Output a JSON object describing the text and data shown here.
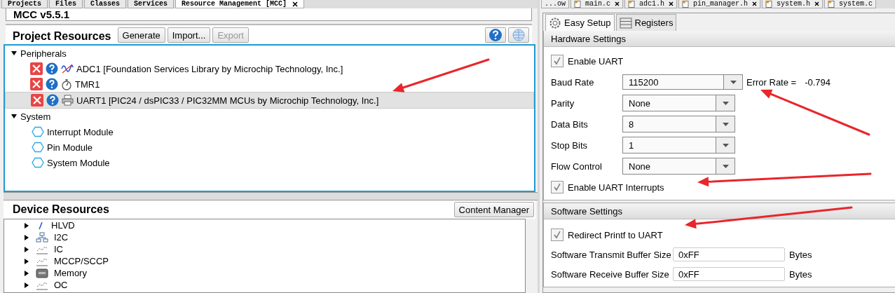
{
  "left_tabs": [
    {
      "label": "Projects",
      "selected": false
    },
    {
      "label": "Files",
      "selected": false
    },
    {
      "label": "Classes",
      "selected": false
    },
    {
      "label": "Services",
      "selected": false
    },
    {
      "label": "Resource Management [MCC]",
      "selected": true
    }
  ],
  "mcc_version": "MCC v5.5.1",
  "project_resources": {
    "title": "Project Resources",
    "buttons": [
      {
        "label": "Generate",
        "disabled": false
      },
      {
        "label": "Import...",
        "disabled": false
      },
      {
        "label": "Export",
        "disabled": true
      }
    ],
    "tree": [
      {
        "label": "Peripherals",
        "expanded": true,
        "children": [
          {
            "label": "ADC1 [Foundation Services Library by Microchip Technology, Inc.]",
            "kind": "wave",
            "selected": false
          },
          {
            "label": "TMR1",
            "kind": "stopwatch",
            "selected": false
          },
          {
            "label": "UART1 [PIC24 / dsPIC33 / PIC32MM MCUs by Microchip Technology, Inc.]",
            "kind": "printer",
            "selected": true
          }
        ]
      },
      {
        "label": "System",
        "expanded": true,
        "children": [
          {
            "label": "Interrupt Module",
            "kind": "hexagon",
            "selected": false
          },
          {
            "label": "Pin Module",
            "kind": "hexagon",
            "selected": false
          },
          {
            "label": "System Module",
            "kind": "hexagon",
            "selected": false
          }
        ]
      }
    ]
  },
  "device_resources": {
    "title": "Device Resources",
    "button": "Content Manager",
    "items": [
      {
        "label": "HLVD",
        "kind": "bolt",
        "expanded": false
      },
      {
        "label": "I2C",
        "kind": "network",
        "expanded": false
      },
      {
        "label": "IC",
        "kind": "signal",
        "expanded": false
      },
      {
        "label": "MCCP/SCCP",
        "kind": "signal",
        "expanded": false
      },
      {
        "label": "Memory",
        "kind": "chip",
        "expanded": false
      },
      {
        "label": "OC",
        "kind": "signal",
        "expanded": false
      }
    ]
  },
  "file_tabs": [
    {
      "label": "...ow",
      "selected": false
    },
    {
      "label": "main.c",
      "selected": false
    },
    {
      "label": "adc1.h",
      "selected": false
    },
    {
      "label": "pin_manager.h",
      "selected": false
    },
    {
      "label": "system.h",
      "selected": false
    },
    {
      "label": "system.c",
      "selected": false
    }
  ],
  "setup_tabs": [
    {
      "label": "Easy Setup",
      "kind": "gear",
      "selected": true
    },
    {
      "label": "Registers",
      "kind": "list",
      "selected": false
    }
  ],
  "hardware_settings": {
    "title": "Hardware Settings",
    "rows": [
      {
        "kind": "checkbox",
        "label": "Enable UART",
        "checked": true
      },
      {
        "kind": "dropdown",
        "label": "Baud Rate",
        "value": "115200",
        "note_label": "Error Rate =",
        "note_value": "-0.794"
      },
      {
        "kind": "dropdown",
        "label": "Parity",
        "value": "None"
      },
      {
        "kind": "dropdown",
        "label": "Data Bits",
        "value": "8"
      },
      {
        "kind": "dropdown",
        "label": "Stop Bits",
        "value": "1"
      },
      {
        "kind": "dropdown",
        "label": "Flow Control",
        "value": "None"
      },
      {
        "kind": "checkbox",
        "label": "Enable UART Interrupts",
        "checked": true
      }
    ]
  },
  "software_settings": {
    "title": "Software Settings",
    "rows": [
      {
        "kind": "checkbox",
        "label": "Redirect Printf to UART",
        "checked": true
      },
      {
        "kind": "text",
        "label": "Software Transmit Buffer Size",
        "value": "0xFF",
        "unit": "Bytes"
      },
      {
        "kind": "text",
        "label": "Software Receive Buffer Size",
        "value": "0xFF",
        "unit": "Bytes"
      }
    ]
  }
}
